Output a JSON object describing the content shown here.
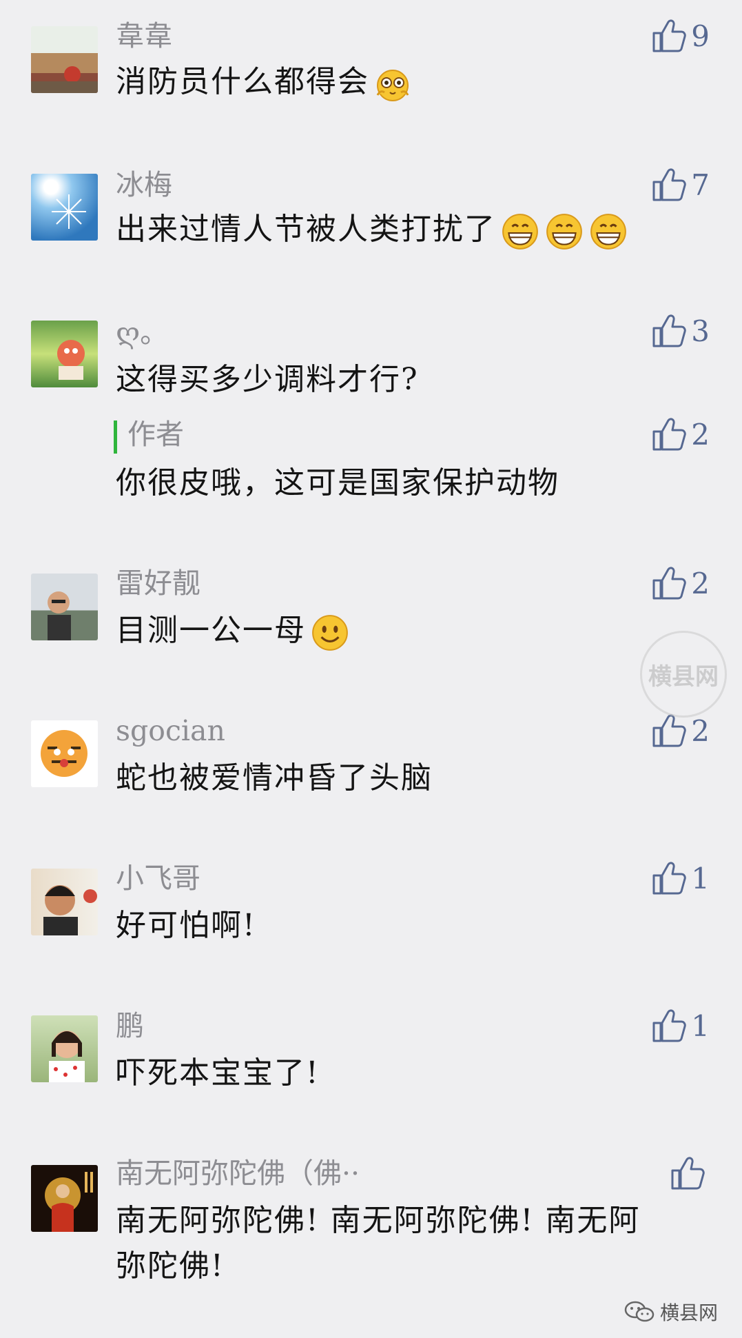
{
  "comments": [
    {
      "name": "韋韋",
      "text": "消防员什么都得会",
      "likes": "9",
      "emoji": "excited"
    },
    {
      "name": "冰梅",
      "text": "出来过情人节被人类打扰了",
      "likes": "7",
      "emoji": "grin x3"
    },
    {
      "name": "ღ。",
      "text": "这得买多少调料才行?",
      "likes": "3",
      "reply": {
        "name": "作者",
        "text": "你很皮哦，这可是国家保护动物",
        "likes": "2"
      }
    },
    {
      "name": "雷好靓",
      "text": "目测一公一母",
      "likes": "2",
      "emoji": "smile"
    },
    {
      "name": "sgocian",
      "text": "蛇也被爱情冲昏了头脑",
      "likes": "2"
    },
    {
      "name": "小飞哥",
      "text": "好可怕啊!",
      "likes": "1"
    },
    {
      "name": "鹏",
      "text": "吓死本宝宝了!",
      "likes": "1"
    },
    {
      "name": "南无阿弥陀佛（佛··",
      "text_line1": "南无阿弥陀佛! 南无阿弥陀佛! 南无阿",
      "text_line2": "弥陀佛!",
      "likes": ""
    }
  ],
  "watermark": {
    "text": "横县网"
  },
  "footer": {
    "brand": "横县网"
  },
  "colors": {
    "name": "#8d8d92",
    "text": "#141414",
    "like": "#566891",
    "reply_bar": "#2fb53c",
    "background": "#efeff1"
  }
}
